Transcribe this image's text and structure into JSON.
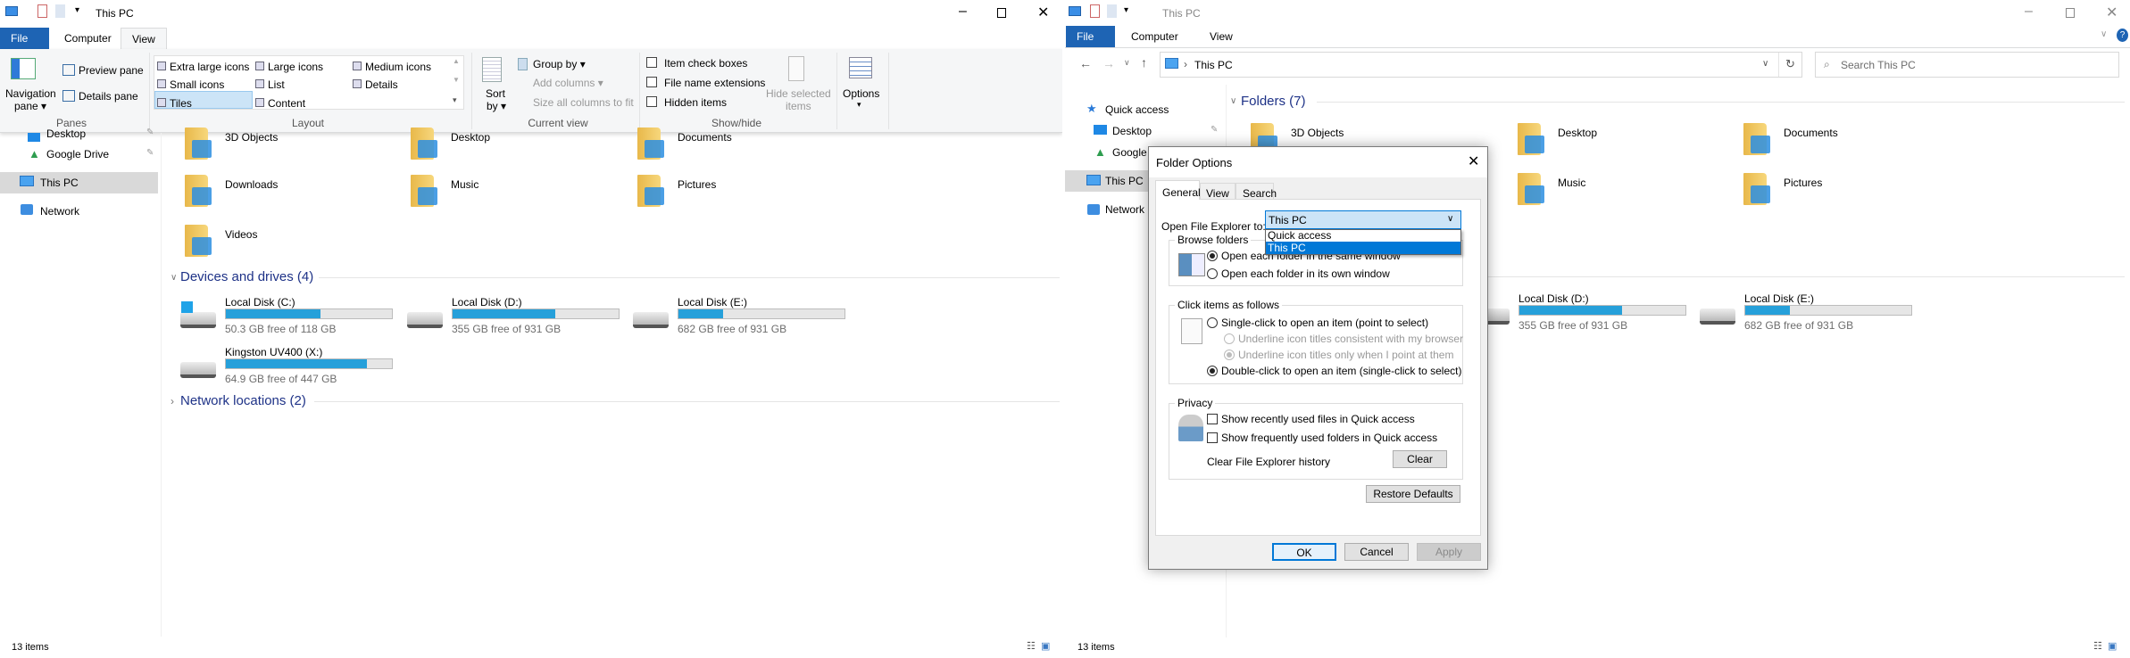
{
  "left": {
    "title": "This PC",
    "tabs": [
      "File",
      "Computer",
      "View"
    ],
    "ribbon": {
      "panes": {
        "label": "Panes",
        "navigation_pane": [
          "Navigation",
          "pane ▾"
        ],
        "preview_pane": "Preview pane",
        "details_pane": "Details pane"
      },
      "layout": {
        "label": "Layout",
        "items": [
          "Extra large icons",
          "Large icons",
          "Medium icons",
          "Small icons",
          "List",
          "Details",
          "Tiles",
          "Content"
        ],
        "selected": "Tiles"
      },
      "current_view": {
        "label": "Current view",
        "sort_by": [
          "Sort",
          "by ▾"
        ],
        "group_by": "Group by ▾",
        "add_columns": "Add columns ▾",
        "size_all": "Size all columns to fit"
      },
      "show_hide": {
        "label": "Show/hide",
        "item_check_boxes": "Item check boxes",
        "file_name_extensions": "File name extensions",
        "hidden_items": "Hidden items",
        "hide_selected": [
          "Hide selected",
          "items"
        ]
      },
      "options": {
        "label": "Options",
        "arrow": "▾"
      }
    },
    "nav": {
      "items": [
        "Desktop",
        "Google Drive",
        "This PC",
        "Network"
      ],
      "selected": "This PC"
    },
    "folders": [
      "3D Objects",
      "Desktop",
      "Documents",
      "Downloads",
      "Music",
      "Pictures",
      "Videos"
    ],
    "devices_header": "Devices and drives (4)",
    "drives": [
      {
        "name": "Local Disk (C:)",
        "free": "50.3 GB free of 118 GB",
        "used_pct": 57
      },
      {
        "name": "Local Disk (D:)",
        "free": "355 GB free of 931 GB",
        "used_pct": 62
      },
      {
        "name": "Local Disk (E:)",
        "free": "682 GB free of 931 GB",
        "used_pct": 27
      },
      {
        "name": "Kingston UV400 (X:)",
        "free": "64.9 GB free of 447 GB",
        "used_pct": 85
      }
    ],
    "network_header": "Network locations (2)",
    "status": "13 items"
  },
  "right": {
    "title": "This PC",
    "tabs": [
      "File",
      "Computer",
      "View"
    ],
    "address": "This PC",
    "search_placeholder": "Search This PC",
    "nav": {
      "items": [
        "Quick access",
        "Desktop",
        "Google",
        "This PC",
        "Network"
      ],
      "selected": "This PC"
    },
    "folders_header": "Folders (7)",
    "folders": [
      "3D Objects",
      "Desktop",
      "Documents",
      "Music",
      "Pictures"
    ],
    "drives": [
      {
        "name": "Local Disk (D:)",
        "free": "355 GB free of 931 GB",
        "used_pct": 62
      },
      {
        "name": "Local Disk (E:)",
        "free": "682 GB free of 931 GB",
        "used_pct": 27
      }
    ],
    "status": "13 items"
  },
  "dialog": {
    "title": "Folder Options",
    "tabs": [
      "General",
      "View",
      "Search"
    ],
    "open_to_label": "Open File Explorer to:",
    "open_to_value": "This PC",
    "open_to_options": [
      "Quick access",
      "This PC"
    ],
    "browse": {
      "label": "Browse folders",
      "same": "Open each folder in the same window",
      "own": "Open each folder in its own window"
    },
    "click": {
      "label": "Click items as follows",
      "single": "Single-click to open an item (point to select)",
      "underline_browser": "Underline icon titles consistent with my browser",
      "underline_point": "Underline icon titles only when I point at them",
      "double": "Double-click to open an item (single-click to select)"
    },
    "privacy": {
      "label": "Privacy",
      "recent_files": "Show recently used files in Quick access",
      "frequent_folders": "Show frequently used folders in Quick access",
      "clear_label": "Clear File Explorer history",
      "clear_button": "Clear"
    },
    "restore_defaults": "Restore Defaults",
    "ok": "OK",
    "cancel": "Cancel",
    "apply": "Apply"
  },
  "colors": {
    "accent": "#1e64b4",
    "selection": "#0078d7",
    "bar": "#26a0da"
  }
}
